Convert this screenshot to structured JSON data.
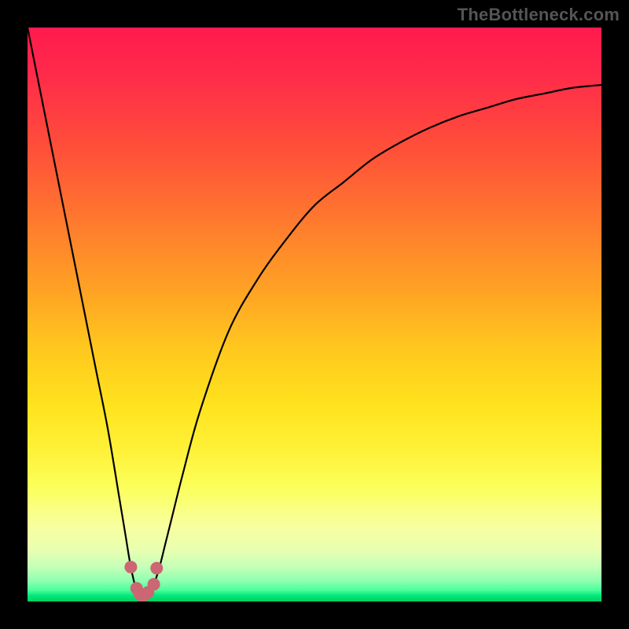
{
  "watermark": "TheBottleneck.com",
  "colors": {
    "frame": "#000000",
    "curve": "#000000",
    "marker": "#cc6673",
    "gradient_top": "#ff1a4d",
    "gradient_bottom": "#00d060"
  },
  "chart_data": {
    "type": "line",
    "title": "",
    "xlabel": "",
    "ylabel": "",
    "xlim": [
      0,
      100
    ],
    "ylim": [
      0,
      100
    ],
    "series": [
      {
        "name": "bottleneck-curve",
        "x": [
          0,
          2,
          4,
          6,
          8,
          10,
          12,
          14,
          16,
          17,
          18,
          19,
          20,
          21,
          22,
          23,
          24,
          25,
          27,
          30,
          35,
          40,
          45,
          50,
          55,
          60,
          65,
          70,
          75,
          80,
          85,
          90,
          95,
          100
        ],
        "values": [
          100,
          90,
          80,
          70,
          60,
          50,
          40,
          30,
          18,
          12,
          6,
          2,
          1,
          1.5,
          3,
          6,
          10,
          14,
          22,
          33,
          47,
          56,
          63,
          69,
          73,
          77,
          80,
          82.5,
          84.5,
          86,
          87.5,
          88.5,
          89.5,
          90
        ]
      }
    ],
    "markers": {
      "name": "minimum-dots",
      "x": [
        18,
        19,
        19.5,
        20,
        20.5,
        21,
        22,
        22.5
      ],
      "values": [
        6,
        2.3,
        1.4,
        1,
        1.2,
        1.6,
        3,
        5.8
      ]
    }
  }
}
